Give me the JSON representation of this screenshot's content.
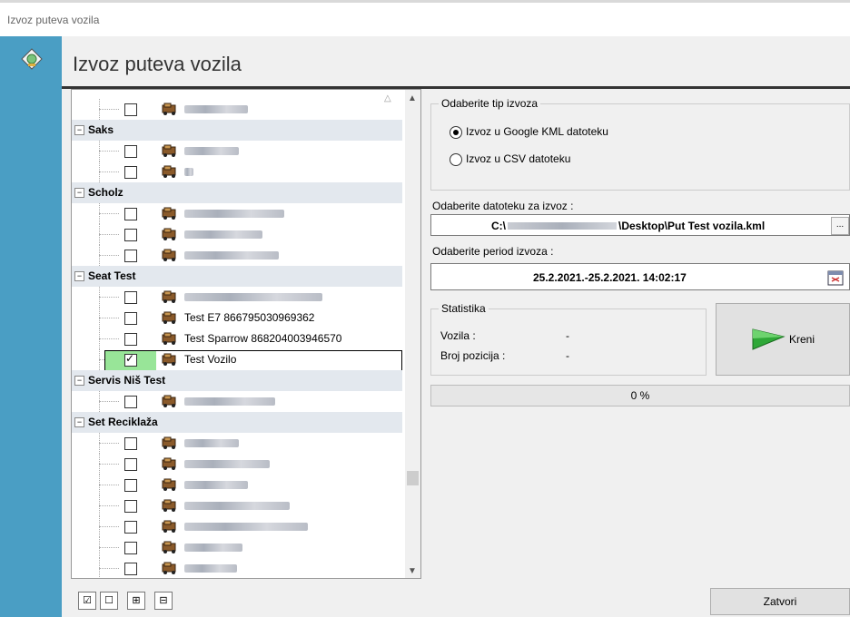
{
  "window": {
    "title": "Izvoz puteva vozila"
  },
  "header": {
    "title": "Izvoz puteva vozila",
    "icon": "globe-disk-icon"
  },
  "tree": {
    "groups": [
      {
        "name": "",
        "items": [
          {
            "label": "",
            "checked": false,
            "redacted": true
          }
        ]
      },
      {
        "name": "Saks",
        "items": [
          {
            "label": "",
            "checked": false,
            "redacted": true
          },
          {
            "label": "",
            "checked": false,
            "redacted": true
          }
        ]
      },
      {
        "name": "Scholz",
        "items": [
          {
            "label": "",
            "checked": false,
            "redacted": true
          },
          {
            "label": "",
            "checked": false,
            "redacted": true
          },
          {
            "label": "",
            "checked": false,
            "redacted": true
          }
        ]
      },
      {
        "name": "Seat Test",
        "items": [
          {
            "label": "",
            "checked": false,
            "redacted": true
          },
          {
            "label": "Test E7 866795030969362",
            "checked": false
          },
          {
            "label": "Test Sparrow 868204003946570",
            "checked": false
          },
          {
            "label": "Test Vozilo",
            "checked": true,
            "selected": true
          }
        ]
      },
      {
        "name": "Servis Niš Test",
        "items": [
          {
            "label": "",
            "checked": false,
            "redacted": true
          }
        ]
      },
      {
        "name": "Set Reciklaža",
        "items": [
          {
            "label": "",
            "checked": false,
            "redacted": true
          },
          {
            "label": "",
            "checked": false,
            "redacted": true
          },
          {
            "label": "",
            "checked": false,
            "redacted": true
          },
          {
            "label": "",
            "checked": false,
            "redacted": true
          },
          {
            "label": "",
            "checked": false,
            "redacted": true
          },
          {
            "label": "",
            "checked": false,
            "redacted": true
          },
          {
            "label": "",
            "checked": false,
            "redacted": true
          }
        ]
      }
    ]
  },
  "export_type": {
    "legend": "Odaberite tip izvoza",
    "option_kml": "Izvoz u Google KML datoteku",
    "option_csv": "Izvoz u CSV datoteku",
    "selected": "kml"
  },
  "file": {
    "label": "Odaberite datoteku za izvoz :",
    "path_start": "C:\\",
    "path_end": "\\Desktop\\Put Test vozila.kml",
    "browse": "..."
  },
  "period": {
    "label": "Odaberite period izvoza :",
    "value": "25.2.2021.-25.2.2021. 14:02:17"
  },
  "stats": {
    "legend": "Statistika",
    "vehicles_label": "Vozila :",
    "vehicles_value": "-",
    "positions_label": "Broj pozicija :",
    "positions_value": "-"
  },
  "start_button": "Kreni",
  "progress": {
    "text": "0 %",
    "value": 0
  },
  "close_button": "Zatvori",
  "colors": {
    "side_blue": "#4a9ec4",
    "group_bg": "#e3e8ee",
    "check_green": "#98e598"
  }
}
